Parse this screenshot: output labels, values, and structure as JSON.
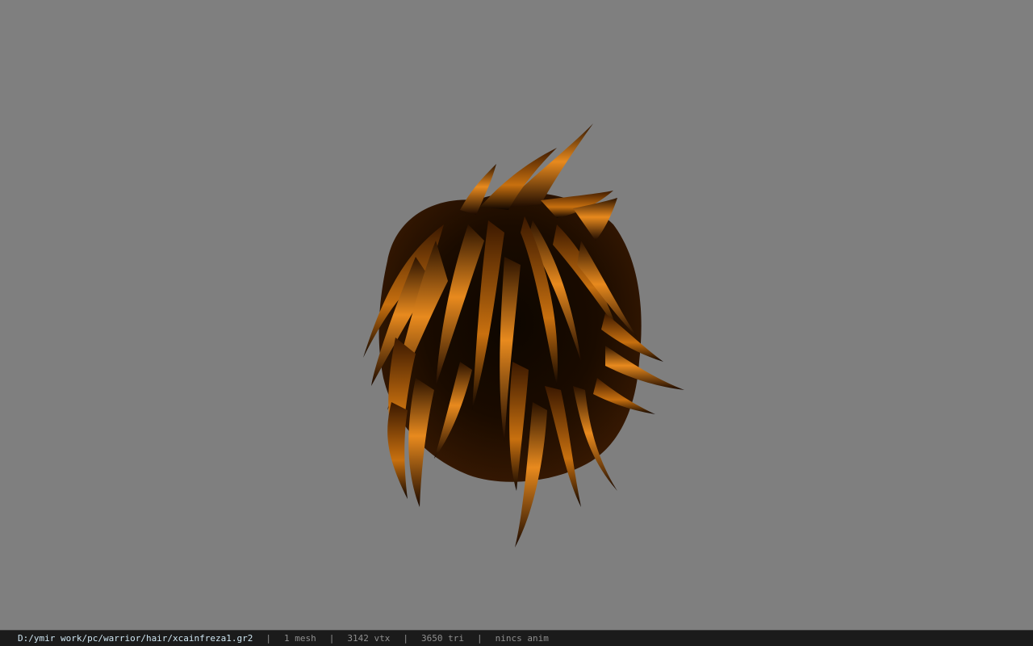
{
  "viewport": {
    "background_color": "#7f7f7f",
    "model": {
      "icon": "hair-mesh",
      "colors": {
        "highlight": "#e88a1e",
        "mid": "#b8600c",
        "shadow": "#0d0600"
      }
    }
  },
  "status_bar": {
    "file_path": "D:/ymir work/pc/warrior/hair/xcainfreza1.gr2",
    "separator": "|",
    "mesh_count": "1 mesh",
    "vertex_count": "3142 vtx",
    "triangle_count": "3650 tri",
    "animation": "nincs anim"
  }
}
